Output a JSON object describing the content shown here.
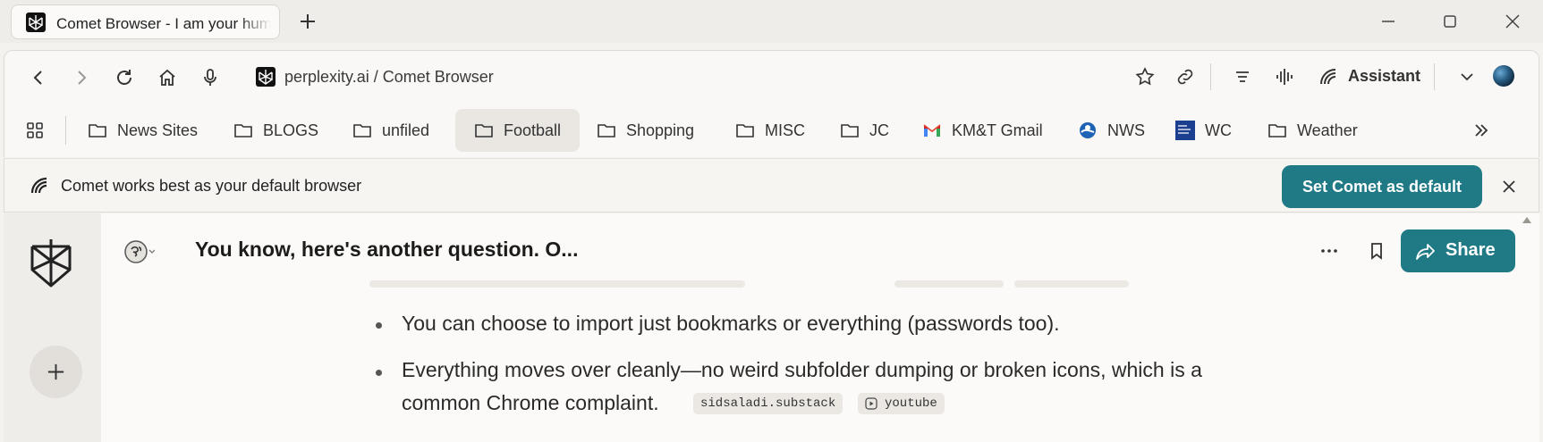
{
  "tab": {
    "title": "Comet Browser - I am your human"
  },
  "address": {
    "text": "perplexity.ai / Comet Browser"
  },
  "toolbar": {
    "assistant_label": "Assistant"
  },
  "bookmarks": [
    {
      "label": "News Sites",
      "icon": "folder-icon"
    },
    {
      "label": "BLOGS",
      "icon": "folder-icon"
    },
    {
      "label": "unfiled",
      "icon": "folder-icon"
    },
    {
      "label": "Football",
      "icon": "folder-icon"
    },
    {
      "label": "Shopping",
      "icon": "folder-icon"
    },
    {
      "label": "MISC",
      "icon": "folder-icon"
    },
    {
      "label": "JC",
      "icon": "folder-icon"
    },
    {
      "label": "KM&T Gmail",
      "icon": "gmail-icon"
    },
    {
      "label": "NWS",
      "icon": "nws-icon"
    },
    {
      "label": "WC",
      "icon": "weather-channel-icon"
    },
    {
      "label": "Weather",
      "icon": "folder-icon"
    }
  ],
  "banner": {
    "text": "Comet works best as your default browser",
    "button": "Set Comet as default"
  },
  "thread": {
    "title": "You know, here's another question. O...",
    "share_label": "Share"
  },
  "answer": {
    "bullets": [
      {
        "text": "You can choose to import just bookmarks or everything (passwords too)."
      },
      {
        "text_line1": "Everything moves over cleanly—no weird subfolder dumping or broken icons, which is a",
        "text_line2": "common Chrome complaint.",
        "sources": [
          "sidsaladi.substack",
          "youtube"
        ]
      }
    ]
  },
  "colors": {
    "accent": "#1f7a85",
    "background": "#f4f2ef",
    "content": "#fbfaf8"
  }
}
